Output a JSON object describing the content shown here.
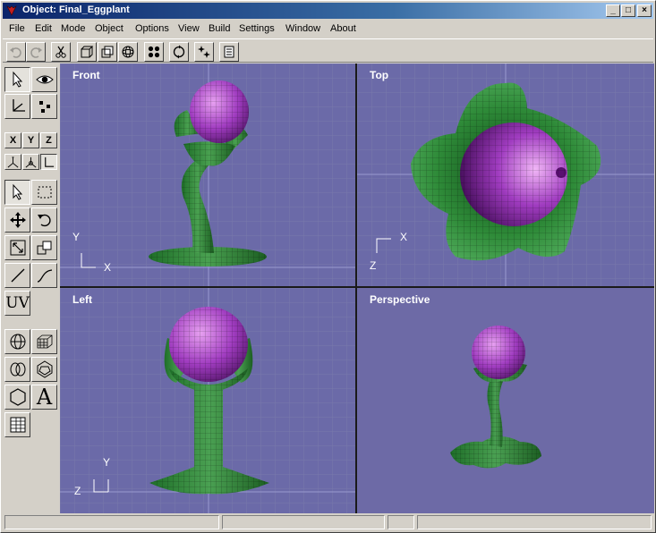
{
  "window": {
    "title": "Object: Final_Eggplant",
    "controls": [
      "_",
      "□",
      "×"
    ]
  },
  "menu": [
    "File",
    "Edit",
    "Mode",
    "Object",
    "Options",
    "View",
    "Build",
    "Settings",
    "Window",
    "About"
  ],
  "toolbar": {
    "icons": [
      "undo-icon",
      "redo-icon",
      "cut-icon",
      "cube-front-icon",
      "cube-back-icon",
      "sphere-icon",
      "quad-dots-icon",
      "rotate-view-icon",
      "sparkle-icon",
      "list-icon"
    ]
  },
  "tools": {
    "axes": [
      "X",
      "Y",
      "Z"
    ],
    "uv_label": "UV",
    "text_tool_label": "A"
  },
  "viewports": [
    {
      "label": "Front",
      "axis_h": "X",
      "axis_v": "Y"
    },
    {
      "label": "Top",
      "axis_h": "X",
      "axis_v": "Z"
    },
    {
      "label": "Left",
      "axis_h": "Z",
      "axis_v": "Y"
    },
    {
      "label": "Perspective"
    }
  ],
  "colors": {
    "viewport_bg": "#6b6aa8",
    "mesh_green": "#2f8f3a",
    "mesh_purple": "#a040c0"
  }
}
